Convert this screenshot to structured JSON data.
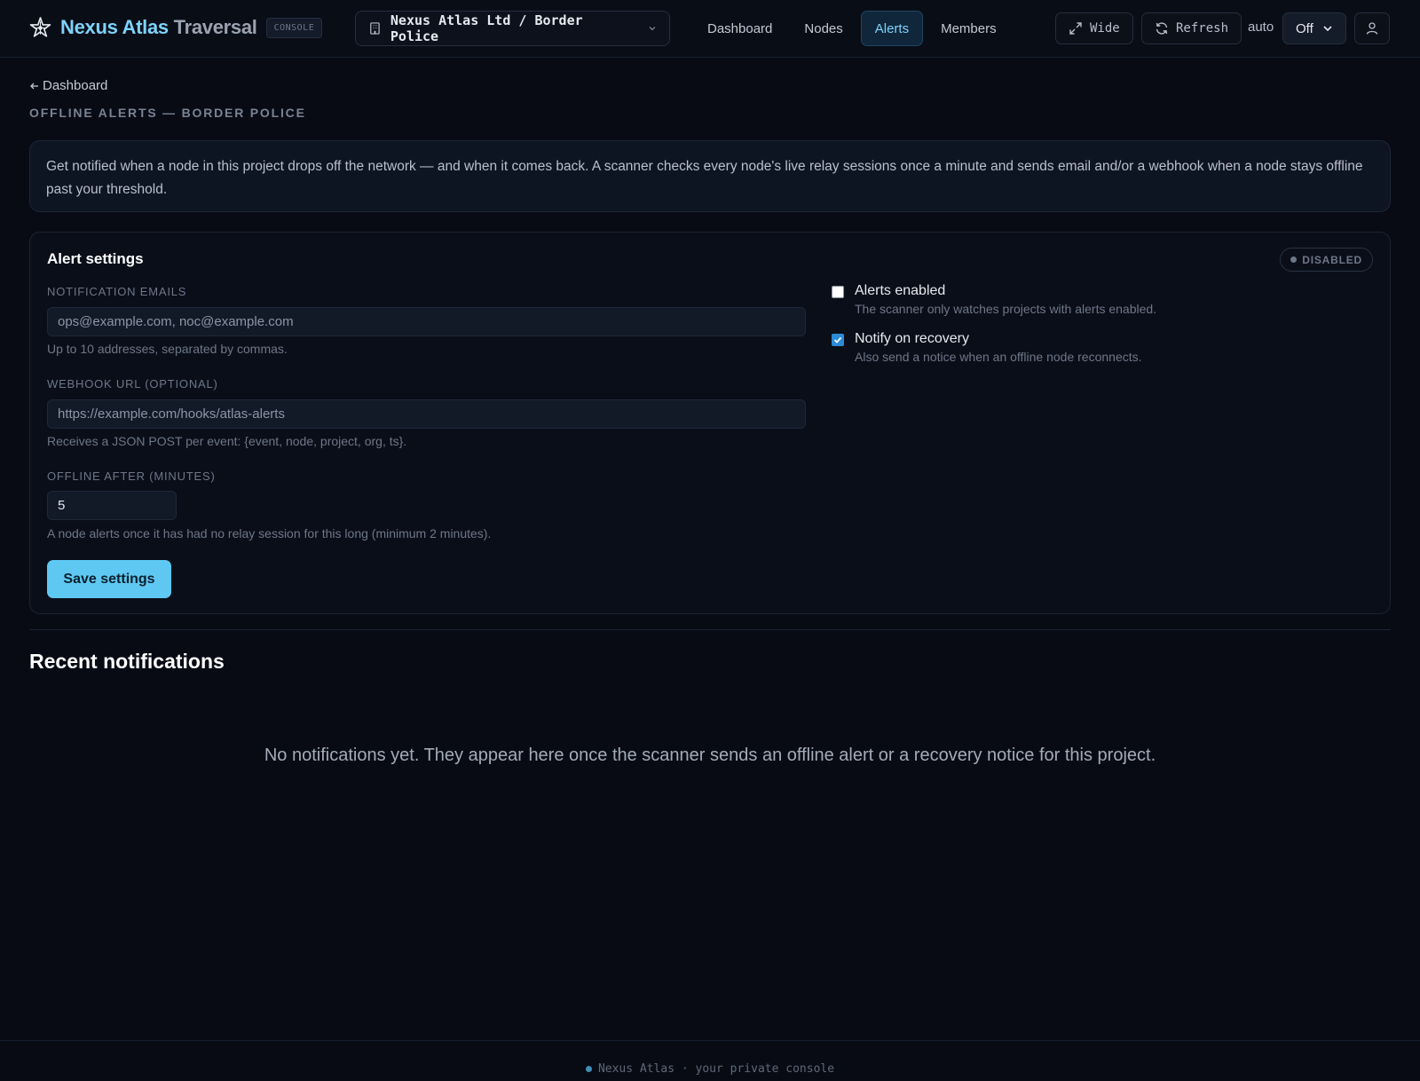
{
  "header": {
    "brand_primary": "Nexus Atlas",
    "brand_secondary": "Traversal",
    "console_badge": "CONSOLE",
    "org_selector": "Nexus Atlas Ltd / Border Police",
    "nav": [
      {
        "label": "Dashboard"
      },
      {
        "label": "Nodes"
      },
      {
        "label": "Alerts",
        "active": true
      },
      {
        "label": "Members"
      }
    ],
    "wide_label": "Wide",
    "refresh_label": "Refresh",
    "auto_label": "auto",
    "auto_value": "Off"
  },
  "breadcrumb": {
    "back_label": "Dashboard"
  },
  "page_title": "OFFLINE ALERTS — BORDER POLICE",
  "intro_text": "Get notified when a node in this project drops off the network — and when it comes back. A scanner checks every node's live relay sessions once a minute and sends email and/or a webhook when a node stays offline past your threshold.",
  "settings": {
    "title": "Alert settings",
    "status_badge": "DISABLED",
    "emails_label": "NOTIFICATION EMAILS",
    "emails_placeholder": "ops@example.com, noc@example.com",
    "emails_help": "Up to 10 addresses, separated by commas.",
    "webhook_label": "WEBHOOK URL (OPTIONAL)",
    "webhook_placeholder": "https://example.com/hooks/atlas-alerts",
    "webhook_help": "Receives a JSON POST per event: {event, node, project, org, ts}.",
    "offline_label": "OFFLINE AFTER (MINUTES)",
    "offline_value": "5",
    "offline_help": "A node alerts once it has had no relay session for this long (minimum 2 minutes).",
    "save_label": "Save settings",
    "alerts_enabled_title": "Alerts enabled",
    "alerts_enabled_desc": "The scanner only watches projects with alerts enabled.",
    "alerts_enabled_checked": false,
    "notify_recovery_title": "Notify on recovery",
    "notify_recovery_desc": "Also send a notice when an offline node reconnects.",
    "notify_recovery_checked": true
  },
  "recent": {
    "title": "Recent notifications",
    "empty_message": "No notifications yet. They appear here once the scanner sends an offline alert or a recovery notice for this project."
  },
  "footer": {
    "text": "Nexus Atlas · your private console"
  },
  "colors": {
    "accent": "#7dd3fc",
    "button": "#5ec8f2",
    "background": "#080b14"
  },
  "icons": [
    "atlas-logo-icon",
    "building-icon",
    "chevron-down-icon",
    "expand-icon",
    "refresh-icon",
    "user-icon",
    "arrow-left-icon"
  ]
}
